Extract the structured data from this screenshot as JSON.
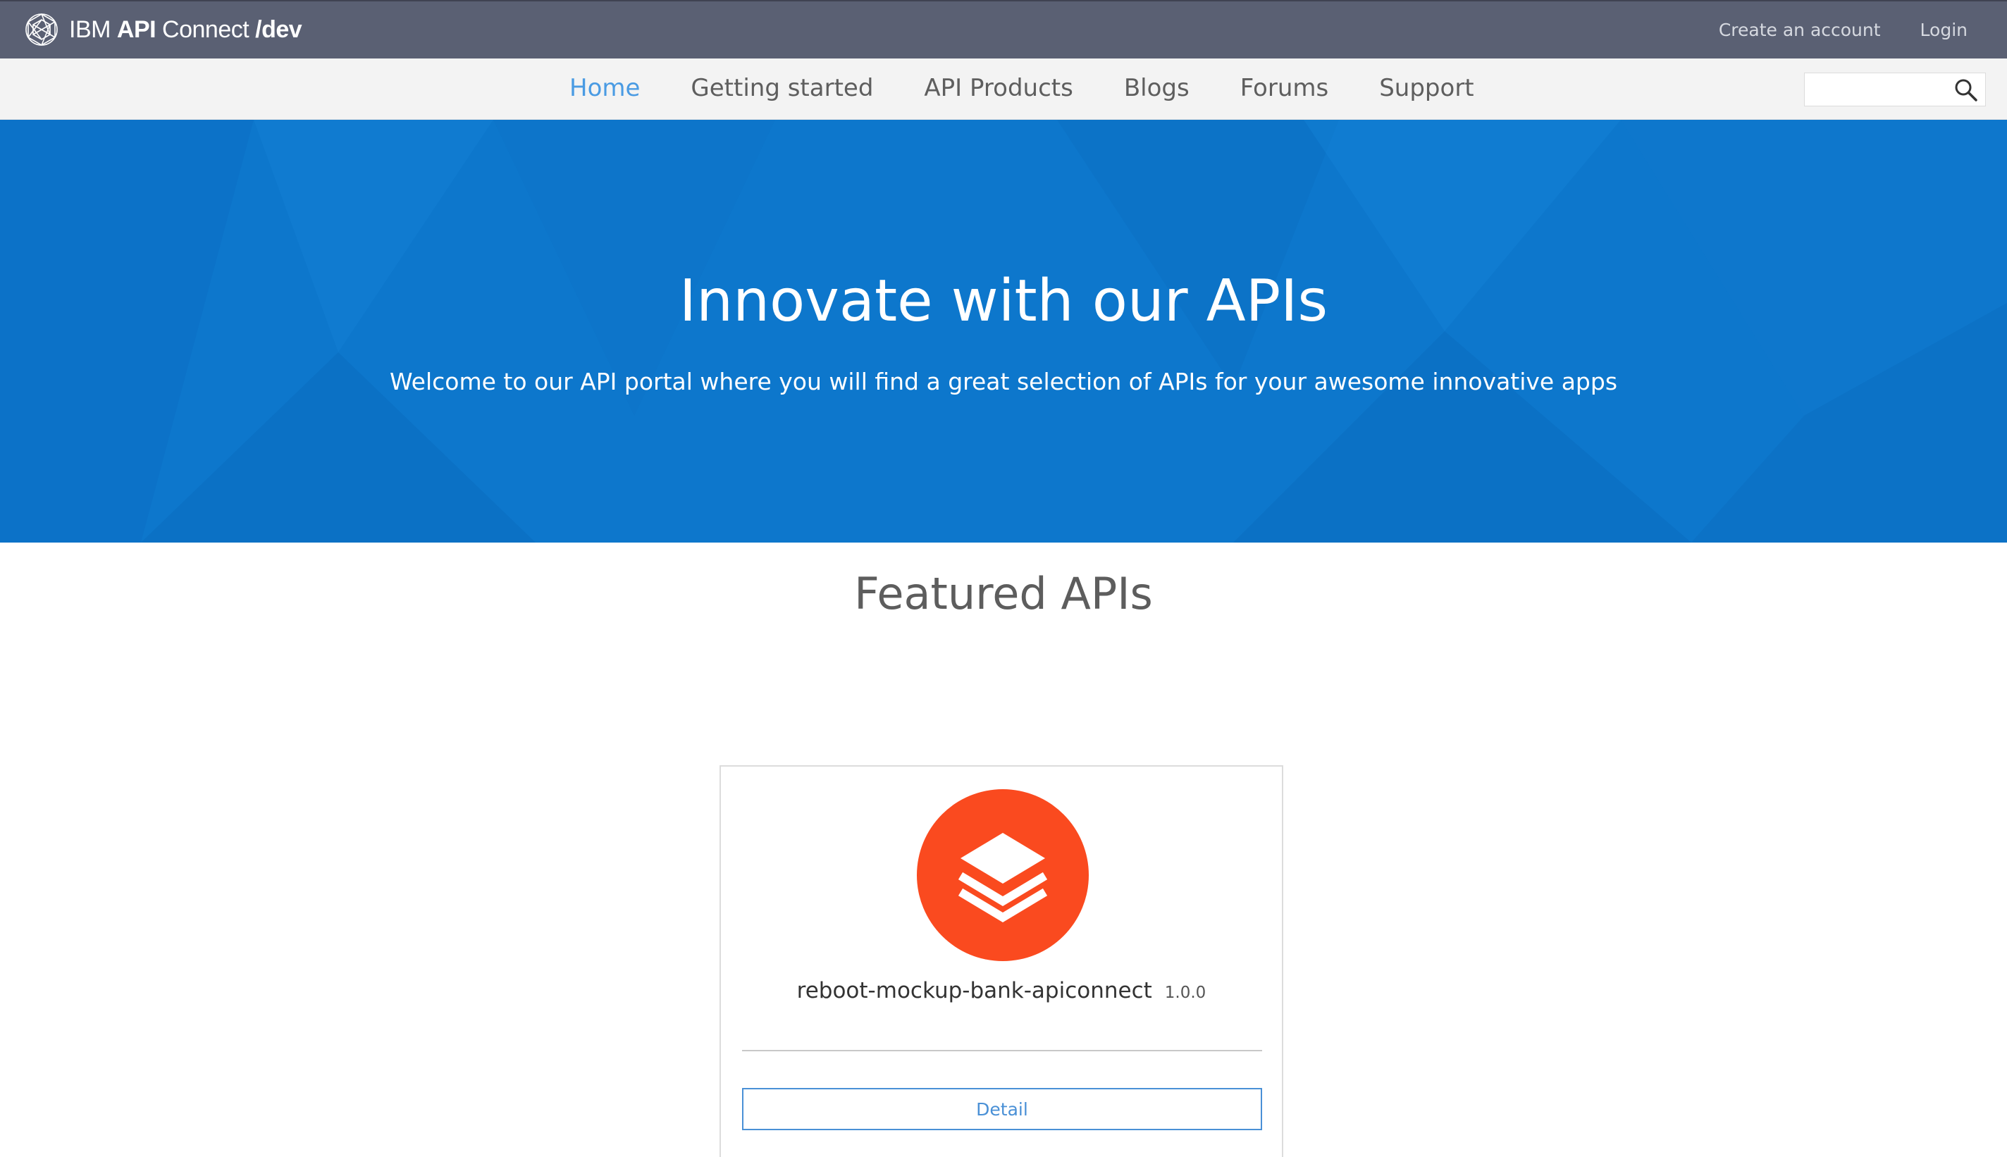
{
  "header": {
    "brand_ibm": "IBM",
    "brand_api": "API",
    "brand_connect": "Connect",
    "brand_dev": "/dev",
    "links": [
      "Create an account",
      "Login"
    ]
  },
  "nav": {
    "items": [
      "Home",
      "Getting started",
      "API Products",
      "Blogs",
      "Forums",
      "Support"
    ],
    "active": "Home",
    "search_placeholder": ""
  },
  "hero": {
    "title": "Innovate with our APIs",
    "subtitle": "Welcome to our API portal where you will find a great selection of APIs for your awesome innovative apps"
  },
  "featured": {
    "title": "Featured APIs",
    "cards": [
      {
        "name": "reboot-mockup-bank-apiconnect",
        "version": "1.0.0",
        "button_label": "Detail",
        "icon": "layers-icon"
      }
    ]
  },
  "colors": {
    "topbar": "#5a6073",
    "nav_active": "#4a9be3",
    "hero": "#0d77cc",
    "card_icon": "#fa4a1f",
    "detail_button": "#4a90d6"
  }
}
